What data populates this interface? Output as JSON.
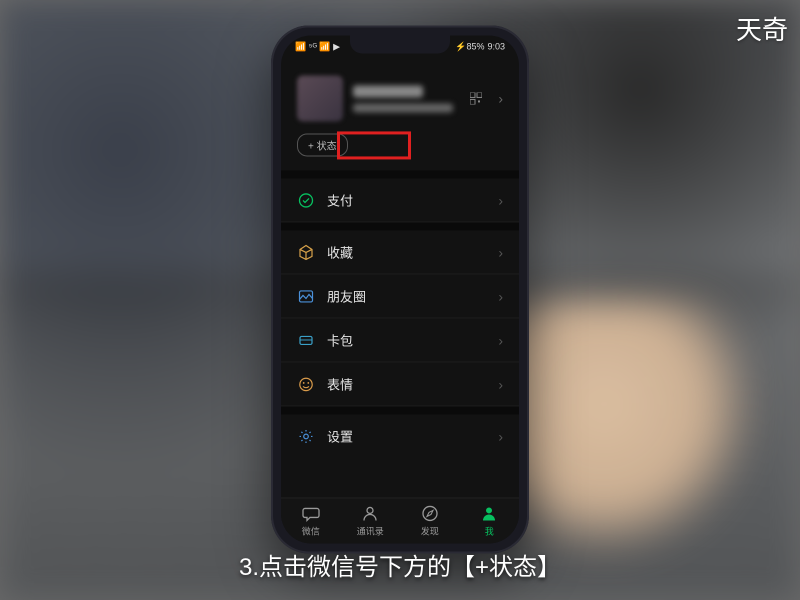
{
  "watermark": "天奇",
  "caption": "3.点击微信号下方的【+状态】",
  "statusbar": {
    "carrier_icons": "📶 ⁵ᴳ 📶 ▶",
    "battery_text": "⚡85%",
    "time": "9:03"
  },
  "profile": {
    "status_button_label": "+ 状态"
  },
  "menu": {
    "pay": "支付",
    "favorites": "收藏",
    "moments": "朋友圈",
    "cards": "卡包",
    "stickers": "表情",
    "settings": "设置"
  },
  "tabs": {
    "chats": "微信",
    "contacts": "通讯录",
    "discover": "发现",
    "me": "我"
  },
  "colors": {
    "accent": "#07c160",
    "highlight": "#e02020"
  }
}
